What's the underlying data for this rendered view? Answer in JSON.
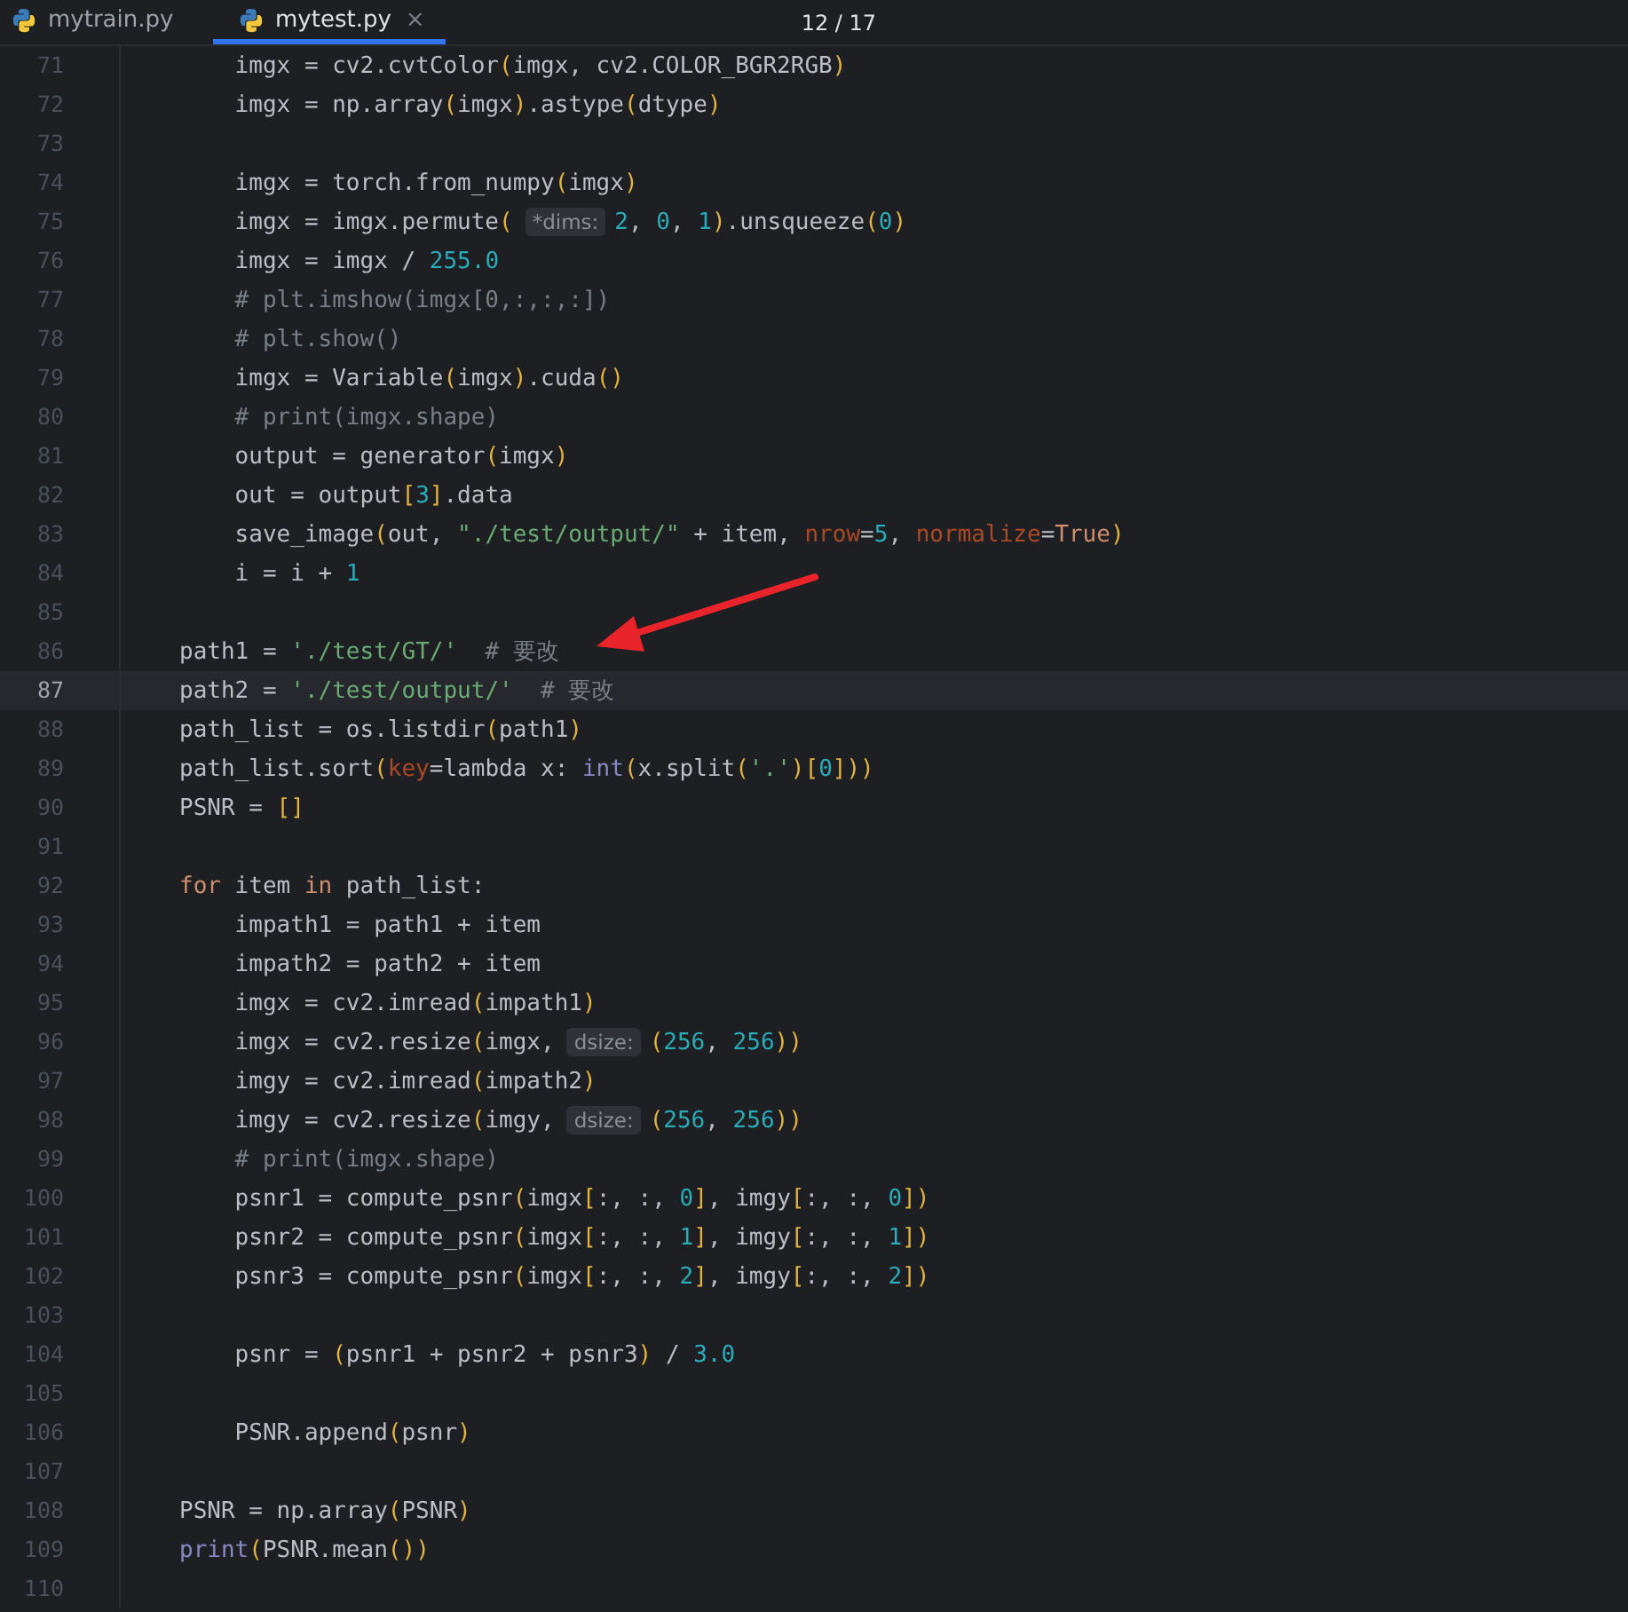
{
  "tabs": [
    {
      "label": "mytrain.py",
      "selected": false
    },
    {
      "label": "mytest.py",
      "selected": true,
      "close_glyph": "×"
    }
  ],
  "counter": "12 / 17",
  "lines": [
    {
      "number": "71",
      "current": false,
      "segments": [
        {
          "kind": "code",
          "tokens": [
            {
              "kind": "t",
              "text": "    imgx = cv2.cvtColor"
            },
            {
              "kind": "y",
              "text": "("
            },
            {
              "kind": "t",
              "text": "imgx, cv2.COLOR_BGR2RGB"
            },
            {
              "kind": "y",
              "text": ")"
            }
          ]
        }
      ]
    },
    {
      "number": "72",
      "current": false,
      "segments": [
        {
          "kind": "code",
          "tokens": [
            {
              "kind": "t",
              "text": "    imgx = np.array"
            },
            {
              "kind": "y",
              "text": "("
            },
            {
              "kind": "t",
              "text": "imgx"
            },
            {
              "kind": "y",
              "text": ")"
            },
            {
              "kind": "t",
              "text": ".astype"
            },
            {
              "kind": "y",
              "text": "("
            },
            {
              "kind": "t",
              "text": "dtype"
            },
            {
              "kind": "y",
              "text": ")"
            }
          ]
        }
      ]
    },
    {
      "number": "73",
      "current": false
    },
    {
      "number": "74",
      "current": false,
      "segments": [
        {
          "kind": "code",
          "tokens": [
            {
              "kind": "t",
              "text": "    imgx = torch.from_numpy"
            },
            {
              "kind": "y",
              "text": "("
            },
            {
              "kind": "t",
              "text": "imgx"
            },
            {
              "kind": "y",
              "text": ")"
            }
          ]
        }
      ]
    },
    {
      "number": "75",
      "current": false,
      "segments": [
        {
          "kind": "code",
          "tokens": [
            {
              "kind": "t",
              "text": "    imgx = imgx.permute"
            },
            {
              "kind": "y",
              "text": "("
            }
          ]
        },
        {
          "kind": "hint",
          "text": "*dims:"
        },
        {
          "kind": "code",
          "tokens": [
            {
              "kind": "n",
              "text": "2"
            },
            {
              "kind": "t",
              "text": ", "
            },
            {
              "kind": "n",
              "text": "0"
            },
            {
              "kind": "t",
              "text": ", "
            },
            {
              "kind": "n",
              "text": "1"
            },
            {
              "kind": "y",
              "text": ")"
            },
            {
              "kind": "t",
              "text": ".unsqueeze"
            },
            {
              "kind": "y",
              "text": "("
            },
            {
              "kind": "n",
              "text": "0"
            },
            {
              "kind": "y",
              "text": ")"
            }
          ]
        }
      ]
    },
    {
      "number": "76",
      "current": false,
      "segments": [
        {
          "kind": "code",
          "tokens": [
            {
              "kind": "t",
              "text": "    imgx = imgx / "
            },
            {
              "kind": "n",
              "text": "255.0"
            }
          ]
        }
      ]
    },
    {
      "number": "77",
      "current": false,
      "segments": [
        {
          "kind": "code",
          "tokens": [
            {
              "kind": "c",
              "text": "    # plt.imshow(imgx[0,:,:,:])"
            }
          ]
        }
      ]
    },
    {
      "number": "78",
      "current": false,
      "segments": [
        {
          "kind": "code",
          "tokens": [
            {
              "kind": "c",
              "text": "    # plt.show()"
            }
          ]
        }
      ]
    },
    {
      "number": "79",
      "current": false,
      "segments": [
        {
          "kind": "code",
          "tokens": [
            {
              "kind": "t",
              "text": "    imgx = Variable"
            },
            {
              "kind": "y",
              "text": "("
            },
            {
              "kind": "t",
              "text": "imgx"
            },
            {
              "kind": "y",
              "text": ")"
            },
            {
              "kind": "t",
              "text": ".cuda"
            },
            {
              "kind": "y",
              "text": "()"
            }
          ]
        }
      ]
    },
    {
      "number": "80",
      "current": false,
      "segments": [
        {
          "kind": "code",
          "tokens": [
            {
              "kind": "c",
              "text": "    # print(imgx.shape)"
            }
          ]
        }
      ]
    },
    {
      "number": "81",
      "current": false,
      "segments": [
        {
          "kind": "code",
          "tokens": [
            {
              "kind": "t",
              "text": "    output = generator"
            },
            {
              "kind": "y",
              "text": "("
            },
            {
              "kind": "t",
              "text": "imgx"
            },
            {
              "kind": "y",
              "text": ")"
            }
          ]
        }
      ]
    },
    {
      "number": "82",
      "current": false,
      "segments": [
        {
          "kind": "code",
          "tokens": [
            {
              "kind": "t",
              "text": "    out = output"
            },
            {
              "kind": "y",
              "text": "["
            },
            {
              "kind": "n",
              "text": "3"
            },
            {
              "kind": "y",
              "text": "]"
            },
            {
              "kind": "t",
              "text": ".data"
            }
          ]
        }
      ]
    },
    {
      "number": "83",
      "current": false,
      "segments": [
        {
          "kind": "code",
          "tokens": [
            {
              "kind": "t",
              "text": "    save_image"
            },
            {
              "kind": "y",
              "text": "("
            },
            {
              "kind": "t",
              "text": "out, "
            },
            {
              "kind": "s",
              "text": "\"./test/output/\""
            },
            {
              "kind": "t",
              "text": " + item, "
            },
            {
              "kind": "p",
              "text": "nrow"
            },
            {
              "kind": "t",
              "text": "="
            },
            {
              "kind": "n",
              "text": "5"
            },
            {
              "kind": "t",
              "text": ", "
            },
            {
              "kind": "p",
              "text": "normalize"
            },
            {
              "kind": "t",
              "text": "="
            },
            {
              "kind": "k",
              "text": "True"
            },
            {
              "kind": "y",
              "text": ")"
            }
          ]
        }
      ]
    },
    {
      "number": "84",
      "current": false,
      "segments": [
        {
          "kind": "code",
          "tokens": [
            {
              "kind": "t",
              "text": "    i = i + "
            },
            {
              "kind": "n",
              "text": "1"
            }
          ]
        }
      ]
    },
    {
      "number": "85",
      "current": false
    },
    {
      "number": "86",
      "current": false,
      "segments": [
        {
          "kind": "code",
          "tokens": [
            {
              "kind": "t",
              "text": "path1 = "
            },
            {
              "kind": "s",
              "text": "'./test/GT/'"
            },
            {
              "kind": "c",
              "text": "  # 要改"
            }
          ]
        }
      ]
    },
    {
      "number": "87",
      "current": true,
      "segments": [
        {
          "kind": "code",
          "tokens": [
            {
              "kind": "t",
              "text": "path2 = "
            },
            {
              "kind": "s",
              "text": "'./test/output/'"
            },
            {
              "kind": "c",
              "text": "  # 要改"
            }
          ]
        }
      ]
    },
    {
      "number": "88",
      "current": false,
      "segments": [
        {
          "kind": "code",
          "tokens": [
            {
              "kind": "t",
              "text": "path_list = os.listdir"
            },
            {
              "kind": "y",
              "text": "("
            },
            {
              "kind": "t",
              "text": "path1"
            },
            {
              "kind": "y",
              "text": ")"
            }
          ]
        }
      ]
    },
    {
      "number": "89",
      "current": false,
      "segments": [
        {
          "kind": "code",
          "tokens": [
            {
              "kind": "t",
              "text": "path_list.sort"
            },
            {
              "kind": "y",
              "text": "("
            },
            {
              "kind": "p",
              "text": "key"
            },
            {
              "kind": "t",
              "text": "=lambda x: "
            },
            {
              "kind": "b",
              "text": "int"
            },
            {
              "kind": "y",
              "text": "("
            },
            {
              "kind": "t",
              "text": "x.split"
            },
            {
              "kind": "y",
              "text": "("
            },
            {
              "kind": "s",
              "text": "'.'"
            },
            {
              "kind": "y",
              "text": ")"
            },
            {
              "kind": "y",
              "text": "["
            },
            {
              "kind": "n",
              "text": "0"
            },
            {
              "kind": "y",
              "text": "]))"
            }
          ]
        }
      ]
    },
    {
      "number": "90",
      "current": false,
      "segments": [
        {
          "kind": "code",
          "tokens": [
            {
              "kind": "t",
              "text": "PSNR = "
            },
            {
              "kind": "y",
              "text": "[]"
            }
          ]
        }
      ]
    },
    {
      "number": "91",
      "current": false
    },
    {
      "number": "92",
      "current": false,
      "segments": [
        {
          "kind": "code",
          "tokens": [
            {
              "kind": "k",
              "text": "for"
            },
            {
              "kind": "t",
              "text": " item "
            },
            {
              "kind": "k",
              "text": "in"
            },
            {
              "kind": "t",
              "text": " path_list:"
            }
          ]
        }
      ]
    },
    {
      "number": "93",
      "current": false,
      "segments": [
        {
          "kind": "code",
          "tokens": [
            {
              "kind": "t",
              "text": "    impath1 = path1 + item"
            }
          ]
        }
      ]
    },
    {
      "number": "94",
      "current": false,
      "segments": [
        {
          "kind": "code",
          "tokens": [
            {
              "kind": "t",
              "text": "    impath2 = path2 + item"
            }
          ]
        }
      ]
    },
    {
      "number": "95",
      "current": false,
      "segments": [
        {
          "kind": "code",
          "tokens": [
            {
              "kind": "t",
              "text": "    imgx = cv2.imread"
            },
            {
              "kind": "y",
              "text": "("
            },
            {
              "kind": "t",
              "text": "impath1"
            },
            {
              "kind": "y",
              "text": ")"
            }
          ]
        }
      ]
    },
    {
      "number": "96",
      "current": false,
      "segments": [
        {
          "kind": "code",
          "tokens": [
            {
              "kind": "t",
              "text": "    imgx = cv2.resize"
            },
            {
              "kind": "y",
              "text": "("
            },
            {
              "kind": "t",
              "text": "imgx,"
            }
          ]
        },
        {
          "kind": "hint",
          "text": "dsize:"
        },
        {
          "kind": "code",
          "tokens": [
            {
              "kind": "y",
              "text": "("
            },
            {
              "kind": "n",
              "text": "256"
            },
            {
              "kind": "t",
              "text": ", "
            },
            {
              "kind": "n",
              "text": "256"
            },
            {
              "kind": "y",
              "text": "))"
            }
          ]
        }
      ]
    },
    {
      "number": "97",
      "current": false,
      "segments": [
        {
          "kind": "code",
          "tokens": [
            {
              "kind": "t",
              "text": "    imgy = cv2.imread"
            },
            {
              "kind": "y",
              "text": "("
            },
            {
              "kind": "t",
              "text": "impath2"
            },
            {
              "kind": "y",
              "text": ")"
            }
          ]
        }
      ]
    },
    {
      "number": "98",
      "current": false,
      "segments": [
        {
          "kind": "code",
          "tokens": [
            {
              "kind": "t",
              "text": "    imgy = cv2.resize"
            },
            {
              "kind": "y",
              "text": "("
            },
            {
              "kind": "t",
              "text": "imgy,"
            }
          ]
        },
        {
          "kind": "hint",
          "text": "dsize:"
        },
        {
          "kind": "code",
          "tokens": [
            {
              "kind": "y",
              "text": "("
            },
            {
              "kind": "n",
              "text": "256"
            },
            {
              "kind": "t",
              "text": ", "
            },
            {
              "kind": "n",
              "text": "256"
            },
            {
              "kind": "y",
              "text": "))"
            }
          ]
        }
      ]
    },
    {
      "number": "99",
      "current": false,
      "segments": [
        {
          "kind": "code",
          "tokens": [
            {
              "kind": "c",
              "text": "    # print(imgx.shape)"
            }
          ]
        }
      ]
    },
    {
      "number": "100",
      "current": false,
      "segments": [
        {
          "kind": "code",
          "tokens": [
            {
              "kind": "t",
              "text": "    psnr1 = compute_psnr"
            },
            {
              "kind": "y",
              "text": "("
            },
            {
              "kind": "t",
              "text": "imgx"
            },
            {
              "kind": "y",
              "text": "["
            },
            {
              "kind": "t",
              "text": ":, :, "
            },
            {
              "kind": "n",
              "text": "0"
            },
            {
              "kind": "y",
              "text": "]"
            },
            {
              "kind": "t",
              "text": ", imgy"
            },
            {
              "kind": "y",
              "text": "["
            },
            {
              "kind": "t",
              "text": ":, :, "
            },
            {
              "kind": "n",
              "text": "0"
            },
            {
              "kind": "y",
              "text": "])"
            }
          ]
        }
      ]
    },
    {
      "number": "101",
      "current": false,
      "segments": [
        {
          "kind": "code",
          "tokens": [
            {
              "kind": "t",
              "text": "    psnr2 = compute_psnr"
            },
            {
              "kind": "y",
              "text": "("
            },
            {
              "kind": "t",
              "text": "imgx"
            },
            {
              "kind": "y",
              "text": "["
            },
            {
              "kind": "t",
              "text": ":, :, "
            },
            {
              "kind": "n",
              "text": "1"
            },
            {
              "kind": "y",
              "text": "]"
            },
            {
              "kind": "t",
              "text": ", imgy"
            },
            {
              "kind": "y",
              "text": "["
            },
            {
              "kind": "t",
              "text": ":, :, "
            },
            {
              "kind": "n",
              "text": "1"
            },
            {
              "kind": "y",
              "text": "])"
            }
          ]
        }
      ]
    },
    {
      "number": "102",
      "current": false,
      "segments": [
        {
          "kind": "code",
          "tokens": [
            {
              "kind": "t",
              "text": "    psnr3 = compute_psnr"
            },
            {
              "kind": "y",
              "text": "("
            },
            {
              "kind": "t",
              "text": "imgx"
            },
            {
              "kind": "y",
              "text": "["
            },
            {
              "kind": "t",
              "text": ":, :, "
            },
            {
              "kind": "n",
              "text": "2"
            },
            {
              "kind": "y",
              "text": "]"
            },
            {
              "kind": "t",
              "text": ", imgy"
            },
            {
              "kind": "y",
              "text": "["
            },
            {
              "kind": "t",
              "text": ":, :, "
            },
            {
              "kind": "n",
              "text": "2"
            },
            {
              "kind": "y",
              "text": "])"
            }
          ]
        }
      ]
    },
    {
      "number": "103",
      "current": false
    },
    {
      "number": "104",
      "current": false,
      "segments": [
        {
          "kind": "code",
          "tokens": [
            {
              "kind": "t",
              "text": "    psnr = "
            },
            {
              "kind": "y",
              "text": "("
            },
            {
              "kind": "t",
              "text": "psnr1 + psnr2 + psnr3"
            },
            {
              "kind": "y",
              "text": ")"
            },
            {
              "kind": "t",
              "text": " / "
            },
            {
              "kind": "n",
              "text": "3.0"
            }
          ]
        }
      ]
    },
    {
      "number": "105",
      "current": false
    },
    {
      "number": "106",
      "current": false,
      "segments": [
        {
          "kind": "code",
          "tokens": [
            {
              "kind": "t",
              "text": "    PSNR.append"
            },
            {
              "kind": "y",
              "text": "("
            },
            {
              "kind": "t",
              "text": "psnr"
            },
            {
              "kind": "y",
              "text": ")"
            }
          ]
        }
      ]
    },
    {
      "number": "107",
      "current": false
    },
    {
      "number": "108",
      "current": false,
      "segments": [
        {
          "kind": "code",
          "tokens": [
            {
              "kind": "t",
              "text": "PSNR = np.array"
            },
            {
              "kind": "y",
              "text": "("
            },
            {
              "kind": "t",
              "text": "PSNR"
            },
            {
              "kind": "y",
              "text": ")"
            }
          ]
        }
      ]
    },
    {
      "number": "109",
      "current": false,
      "segments": [
        {
          "kind": "code",
          "tokens": [
            {
              "kind": "b",
              "text": "print"
            },
            {
              "kind": "y",
              "text": "("
            },
            {
              "kind": "t",
              "text": "PSNR.mean"
            },
            {
              "kind": "y",
              "text": "())"
            }
          ]
        }
      ]
    },
    {
      "number": "110",
      "current": false
    }
  ]
}
